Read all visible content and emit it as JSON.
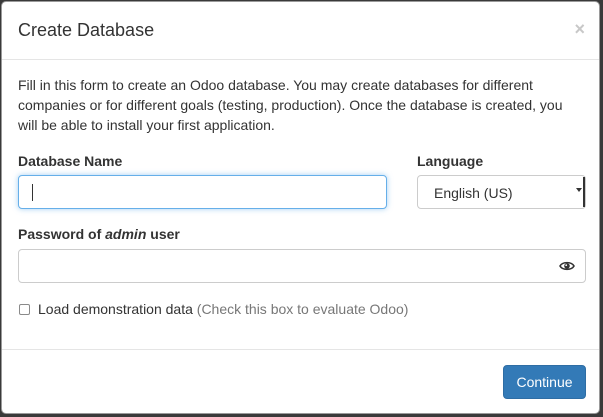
{
  "dialog": {
    "title": "Create Database",
    "close_glyph": "×",
    "intro": "Fill in this form to create an Odoo database. You may create databases for different companies or for different goals (testing, production). Once the database is created, you will be able to install your first application."
  },
  "form": {
    "database_name": {
      "label": "Database Name",
      "value": ""
    },
    "language": {
      "label": "Language",
      "selected": "English (US)"
    },
    "password": {
      "label_prefix": "Password of ",
      "label_em": "admin",
      "label_suffix": " user",
      "value": "",
      "toggle_icon": "eye-icon"
    },
    "demo_data": {
      "label": "Load demonstration data",
      "hint": "(Check this box to evaluate Odoo)",
      "checked": false
    }
  },
  "footer": {
    "continue_label": "Continue"
  },
  "colors": {
    "primary": "#337ab7",
    "focus": "#66afe9",
    "text": "#333333",
    "muted": "#777777"
  }
}
